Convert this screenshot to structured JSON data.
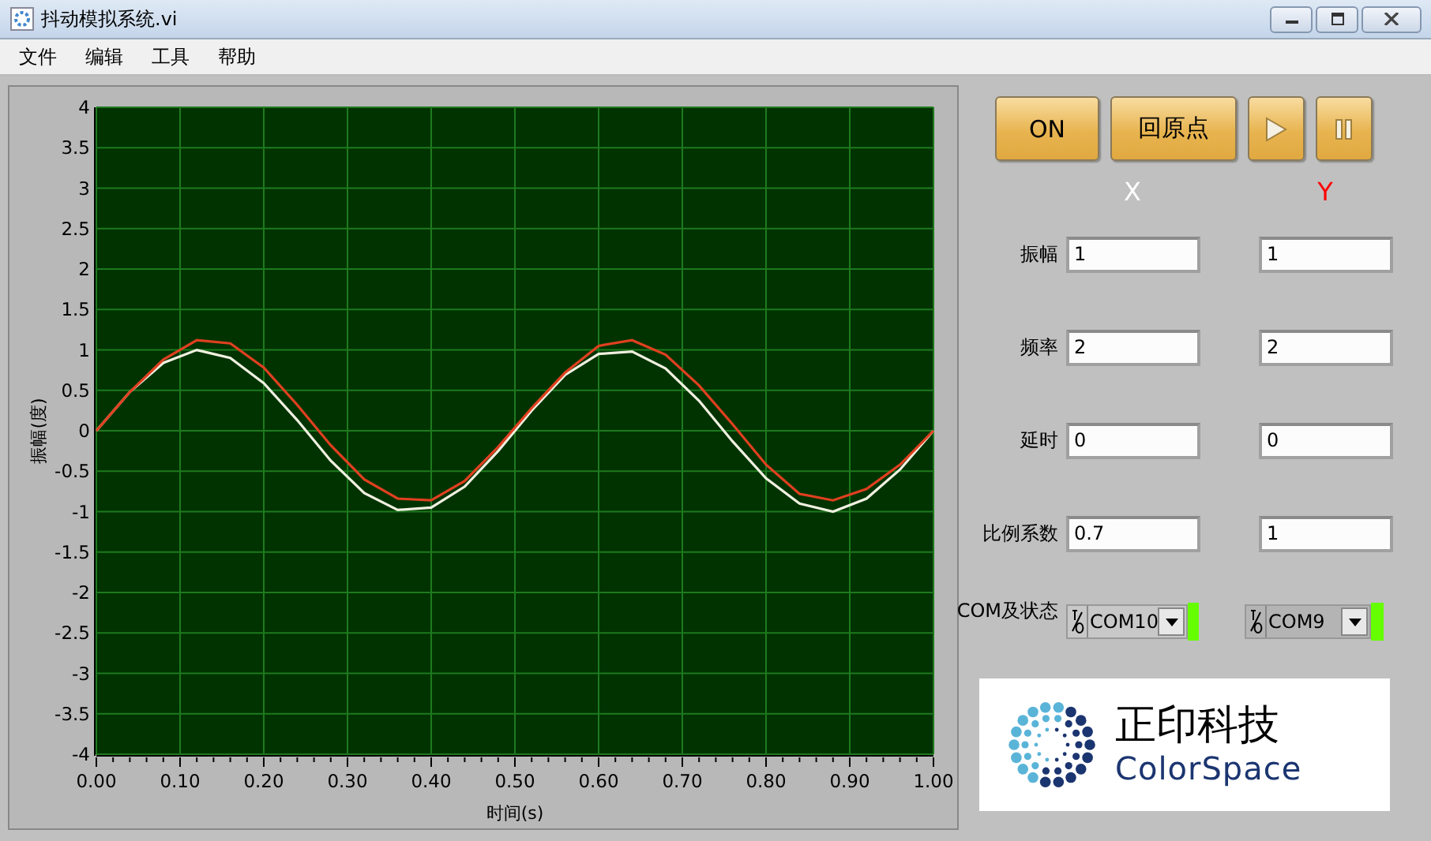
{
  "window": {
    "title": "抖动模拟系统.vi"
  },
  "menu": [
    "文件",
    "编辑",
    "工具",
    "帮助"
  ],
  "chart": {
    "chart_data": {
      "type": "line",
      "xlabel": "时间(s)",
      "ylabel": "振幅(度)",
      "x": [
        0,
        0.04,
        0.08,
        0.12,
        0.16,
        0.2,
        0.24,
        0.28,
        0.32,
        0.36,
        0.4,
        0.44,
        0.48,
        0.52,
        0.56,
        0.6,
        0.64,
        0.68,
        0.72,
        0.76,
        0.8,
        0.84,
        0.88,
        0.92,
        0.96,
        1
      ],
      "series": [
        {
          "color": "#f0f0e0",
          "values": [
            0,
            0.48,
            0.84,
            1.0,
            0.9,
            0.59,
            0.13,
            -0.37,
            -0.77,
            -0.98,
            -0.95,
            -0.69,
            -0.25,
            0.25,
            0.69,
            0.95,
            0.98,
            0.77,
            0.37,
            -0.13,
            -0.59,
            -0.9,
            -1.0,
            -0.84,
            -0.48,
            0
          ]
        },
        {
          "color": "#e04020",
          "values": [
            0,
            0.48,
            0.88,
            1.12,
            1.08,
            0.78,
            0.32,
            -0.18,
            -0.6,
            -0.84,
            -0.86,
            -0.62,
            -0.2,
            0.28,
            0.72,
            1.05,
            1.12,
            0.94,
            0.56,
            0.08,
            -0.42,
            -0.78,
            -0.86,
            -0.72,
            -0.42,
            0
          ]
        }
      ],
      "grid": true,
      "xlim": [
        0,
        1
      ],
      "ylim": [
        -4,
        4
      ],
      "xticks": [
        {
          "value": 0,
          "label": "0.00"
        },
        {
          "value": 0.1,
          "label": "0.10"
        },
        {
          "value": 0.2,
          "label": "0.20"
        },
        {
          "value": 0.3,
          "label": "0.30"
        },
        {
          "value": 0.4,
          "label": "0.40"
        },
        {
          "value": 0.5,
          "label": "0.50"
        },
        {
          "value": 0.6,
          "label": "0.60"
        },
        {
          "value": 0.7,
          "label": "0.70"
        },
        {
          "value": 0.8,
          "label": "0.80"
        },
        {
          "value": 0.9,
          "label": "0.90"
        },
        {
          "value": 1,
          "label": "1.00"
        }
      ],
      "yticks": [
        4,
        3.5,
        3,
        2.5,
        2,
        1.5,
        1,
        0.5,
        0,
        -0.5,
        -1,
        -1.5,
        -2,
        -2.5,
        -3,
        -3.5,
        -4
      ]
    }
  },
  "buttons": [
    {
      "kind": "text",
      "label": "ON"
    },
    {
      "kind": "text",
      "label": "回原点"
    },
    {
      "kind": "play"
    },
    {
      "kind": "pause"
    }
  ],
  "columns": [
    {
      "label": "X",
      "color": "#ffffff"
    },
    {
      "label": "Y",
      "color": "#ff0000"
    }
  ],
  "params": [
    {
      "label": "振幅",
      "values": [
        "1",
        "1"
      ]
    },
    {
      "label": "频率",
      "values": [
        "2",
        "2"
      ]
    },
    {
      "label": "延时",
      "values": [
        "0",
        "0"
      ]
    },
    {
      "label": "比例系数",
      "values": [
        "0.7",
        "1"
      ]
    }
  ],
  "com": {
    "label": "COM及状态",
    "ports": [
      {
        "value": "COM10",
        "led_on": true
      },
      {
        "value": "COM9",
        "led_on": true
      }
    ]
  },
  "logo": {
    "name": "正印科技",
    "brand": "ColorSpace"
  }
}
